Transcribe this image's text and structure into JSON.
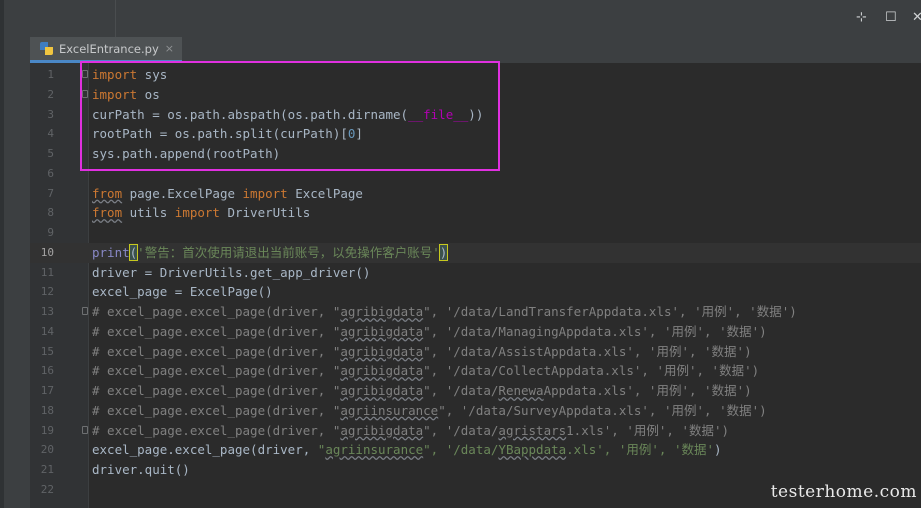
{
  "window": {
    "pin_glyph": "⊹",
    "maximize_glyph": "☐",
    "close_glyph": "✕"
  },
  "tab": {
    "filename": "ExcelEntrance.py",
    "close_glyph": "×",
    "icon": "python-file-icon"
  },
  "watermark": "testerhome.com",
  "current_line": 10,
  "lines": [
    {
      "n": "1",
      "fold": true,
      "tokens": [
        {
          "t": "import",
          "c": "kw"
        },
        {
          "t": " sys"
        }
      ]
    },
    {
      "n": "2",
      "fold": true,
      "tokens": [
        {
          "t": "import",
          "c": "kw"
        },
        {
          "t": " os"
        }
      ]
    },
    {
      "n": "3",
      "tokens": [
        {
          "t": "curPath = os.path.abspath(os.path.dirname("
        },
        {
          "t": "__file__",
          "c": "dunder"
        },
        {
          "t": "))"
        }
      ]
    },
    {
      "n": "4",
      "tokens": [
        {
          "t": "rootPath = os.path.split(curPath)["
        },
        {
          "t": "0",
          "c": "num"
        },
        {
          "t": "]"
        }
      ]
    },
    {
      "n": "5",
      "tokens": [
        {
          "t": "sys.path.append(rootPath)"
        }
      ]
    },
    {
      "n": "6",
      "tokens": []
    },
    {
      "n": "7",
      "tokens": [
        {
          "t": "from",
          "c": "kw ul"
        },
        {
          "t": " page.ExcelPage "
        },
        {
          "t": "import",
          "c": "kw"
        },
        {
          "t": " ExcelPage"
        }
      ]
    },
    {
      "n": "8",
      "tokens": [
        {
          "t": "from",
          "c": "kw ul"
        },
        {
          "t": " utils "
        },
        {
          "t": "import",
          "c": "kw"
        },
        {
          "t": " DriverUtils"
        }
      ]
    },
    {
      "n": "9",
      "tokens": []
    },
    {
      "n": "10",
      "tokens": [
        {
          "t": "print",
          "c": "bi"
        },
        {
          "t": "(",
          "c": "paren-hl"
        },
        {
          "t": "'警告：首次使用请退出当前账号，以免操作客户账号'",
          "c": "str"
        },
        {
          "t": ")",
          "c": "paren-hl"
        }
      ]
    },
    {
      "n": "11",
      "tokens": [
        {
          "t": "driver = DriverUtils.get_app_driver()"
        }
      ]
    },
    {
      "n": "12",
      "tokens": [
        {
          "t": "excel_page = ExcelPage()"
        }
      ]
    },
    {
      "n": "13",
      "fold": true,
      "tokens": [
        {
          "t": "# excel_page.excel_page(driver, \"",
          "c": "cmt"
        },
        {
          "t": "agribigdata",
          "c": "cmt ul"
        },
        {
          "t": "\", '/data/LandTransferAppdata.xls', '用例', '数据')",
          "c": "cmt"
        }
      ]
    },
    {
      "n": "14",
      "tokens": [
        {
          "t": "# excel_page.excel_page(driver, \"",
          "c": "cmt"
        },
        {
          "t": "agribigdata",
          "c": "cmt ul"
        },
        {
          "t": "\", '/data/ManagingAppdata.xls', '用例', '数据')",
          "c": "cmt"
        }
      ]
    },
    {
      "n": "15",
      "tokens": [
        {
          "t": "# excel_page.excel_page(driver, \"",
          "c": "cmt"
        },
        {
          "t": "agribigdata",
          "c": "cmt ul"
        },
        {
          "t": "\", '/data/AssistAppdata.xls', '用例', '数据')",
          "c": "cmt"
        }
      ]
    },
    {
      "n": "16",
      "tokens": [
        {
          "t": "# excel_page.excel_page(driver, \"",
          "c": "cmt"
        },
        {
          "t": "agribigdata",
          "c": "cmt ul"
        },
        {
          "t": "\", '/data/CollectAppdata.xls', '用例', '数据')",
          "c": "cmt"
        }
      ]
    },
    {
      "n": "17",
      "tokens": [
        {
          "t": "# excel_page.excel_page(driver, \"",
          "c": "cmt"
        },
        {
          "t": "agribigdata",
          "c": "cmt ul"
        },
        {
          "t": "\", '/data/",
          "c": "cmt"
        },
        {
          "t": "Renewa",
          "c": "cmt ul"
        },
        {
          "t": "Appdata.xls', '用例', '数据')",
          "c": "cmt"
        }
      ]
    },
    {
      "n": "18",
      "tokens": [
        {
          "t": "# excel_page.excel_page(driver, \"",
          "c": "cmt"
        },
        {
          "t": "agriinsurance",
          "c": "cmt ul"
        },
        {
          "t": "\", '/data/SurveyAppdata.xls', '用例', '数据')",
          "c": "cmt"
        }
      ]
    },
    {
      "n": "19",
      "fold": true,
      "tokens": [
        {
          "t": "# excel_page.excel_page(driver, \"",
          "c": "cmt"
        },
        {
          "t": "agribigdata",
          "c": "cmt ul"
        },
        {
          "t": "\", '/data/",
          "c": "cmt"
        },
        {
          "t": "agristars",
          "c": "cmt ul"
        },
        {
          "t": "1.xls', '用例', '数据')",
          "c": "cmt"
        }
      ]
    },
    {
      "n": "20",
      "tokens": [
        {
          "t": "excel_page.excel_page(driver, "
        },
        {
          "t": "\"",
          "c": "str"
        },
        {
          "t": "agriinsurance",
          "c": "str ul"
        },
        {
          "t": "\", '/data/",
          "c": "str"
        },
        {
          "t": "YBappdata",
          "c": "str ul"
        },
        {
          "t": ".xls', '用例', '数据'",
          "c": "str"
        },
        {
          "t": ")"
        }
      ]
    },
    {
      "n": "21",
      "tokens": [
        {
          "t": "driver.quit()"
        }
      ]
    },
    {
      "n": "22",
      "tokens": []
    }
  ]
}
